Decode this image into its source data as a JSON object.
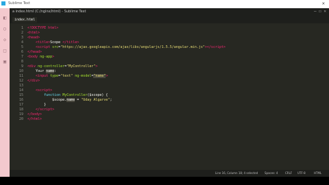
{
  "window": {
    "app_title": "a index.html (C:/nginx/html) - Sublime Text",
    "controls": "— ☐ ✕"
  },
  "topstrip": {
    "title": "Sublime Text",
    "right": "✕"
  },
  "tabs": [
    {
      "label": "index.html"
    }
  ],
  "lines": [
    {
      "n": "1",
      "html": "<span class=\"tag\">&lt;!DOCTYPE html&gt;</span>"
    },
    {
      "n": "2",
      "html": "<span class=\"tag\">&lt;html&gt;</span>"
    },
    {
      "n": "3",
      "html": "<span class=\"tag\">&lt;head&gt;</span>"
    },
    {
      "n": "4",
      "html": "    <span class=\"tag\">&lt;title&gt;</span>Scope <span class=\"tag\">&lt;/title&gt;</span>"
    },
    {
      "n": "5",
      "html": "    <span class=\"tag\">&lt;script</span> <span class=\"attr\">src</span>=<span class=\"str\">\"https://ajax.googleapis.com/ajax/libs/angularjs/1.5.5/angular.min.js\"</span><span class=\"tag\">&gt;&lt;/script&gt;</span>"
    },
    {
      "n": "6",
      "html": "<span class=\"tag\">&lt;/head&gt;</span>"
    },
    {
      "n": "7",
      "html": "<span class=\"tag\">&lt;body</span> <span class=\"attr\">ng-app</span><span class=\"tag\">&gt;</span>"
    },
    {
      "n": "8",
      "html": ""
    },
    {
      "n": "9",
      "html": "<span class=\"tag\">&lt;div</span> <span class=\"attr\">ng-controller</span>=<span class=\"str\">\"MyController\"</span><span class=\"tag\">&gt;</span>"
    },
    {
      "n": "10",
      "html": "    Your <span class=\"sel\">name</span>:"
    },
    {
      "n": "11",
      "html": "    <span class=\"tag\">&lt;input</span> <span class=\"attr\">type</span>=<span class=\"str\">\"text\"</span> <span class=\"attr\">ng-model</span>=<span class=\"str sel\">\"name\"</span><span class=\"tag\">&gt;</span>"
    },
    {
      "n": "12",
      "html": "<span class=\"tag\">&lt;/div&gt;</span>"
    },
    {
      "n": "13",
      "html": ""
    },
    {
      "n": "14",
      "html": "    <span class=\"tag\">&lt;script&gt;</span>"
    },
    {
      "n": "15",
      "html": "        <span class=\"kw\">function</span> <span class=\"attr\">MyController</span>($scope) {"
    },
    {
      "n": "16",
      "html": "            $scope.<span class=\"sel\">name</span> = <span class=\"str\">\"Uday Algarve\"</span>;"
    },
    {
      "n": "17",
      "html": "        }"
    },
    {
      "n": "18",
      "html": "    <span class=\"tag\">&lt;/script&gt;</span>"
    },
    {
      "n": "19",
      "html": "<span class=\"tag\">&lt;/body&gt;</span>"
    },
    {
      "n": "20",
      "html": "<span class=\"tag\">&lt;/html&gt;</span>"
    }
  ],
  "status": {
    "position": "Line 16, Column 18; 4 selected",
    "spaces": "Spaces: 4",
    "line_ending": "CRLF",
    "encoding": "UTF-8",
    "syntax": "HTML"
  },
  "colors": {
    "background": "#272822",
    "tag": "#f92672",
    "attr": "#a6e22e",
    "string": "#e6db74",
    "keyword": "#66d9ef",
    "sidebar": "#f3c9ce"
  },
  "sidebar_icons": [
    "file-icon",
    "search-icon",
    "git-icon",
    "debug-icon",
    "extensions-icon"
  ]
}
